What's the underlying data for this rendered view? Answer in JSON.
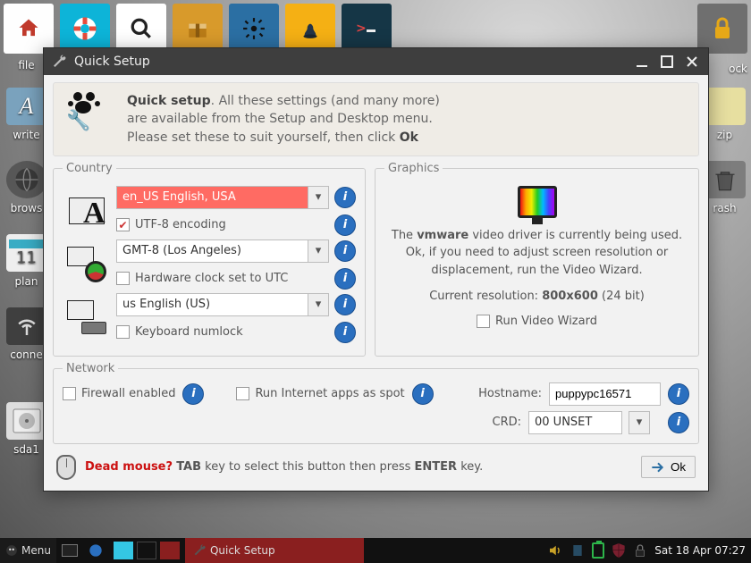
{
  "top_toolbar": {
    "labels": [
      "file",
      "",
      "",
      "",
      "",
      "",
      "",
      "",
      "ock"
    ]
  },
  "desktop_icons_left": [
    "file",
    "write",
    "brows",
    "plan",
    "conne",
    "sda1"
  ],
  "desktop_icons_right": [
    "ock",
    "zip",
    "rash"
  ],
  "calendar_day": "11",
  "window": {
    "title": "Quick Setup",
    "intro_bold": "Quick setup",
    "intro_rest": ". All these settings (and many more) are available from the Setup and Desktop menu. Please set these to suit yourself, then click ",
    "intro_ok": "Ok",
    "country_legend": "Country",
    "graphics_legend": "Graphics",
    "network_legend": "Network",
    "lang": {
      "code": "en_US",
      "label": "English, USA"
    },
    "lang_combined": "en_US     English, USA",
    "utf8": "UTF-8 encoding",
    "tz": {
      "code": "GMT-8",
      "label": "(Los Angeles)"
    },
    "tz_combined": "GMT-8     (Los Angeles)",
    "hw_utc": "Hardware clock set to UTC",
    "kb": {
      "code": "us",
      "label": "English (US)"
    },
    "kb_combined": "us           English (US)",
    "numlock": "Keyboard numlock",
    "graphics_text1_a": "The ",
    "graphics_text1_driver": "vmware",
    "graphics_text1_b": " video driver is currently being used. Ok, if you need to adjust screen resolution or displacement, run the Video Wizard.",
    "graphics_res_label": "Current resolution: ",
    "graphics_res": "800x600",
    "graphics_depth": "  (24 bit)",
    "run_video_wizard": "Run Video Wizard",
    "firewall": "Firewall enabled",
    "spot": "Run Internet apps as spot",
    "hostname_label": "Hostname:",
    "hostname": "puppypc16571",
    "crd_label": "CRD:",
    "crd_value": "00 UNSET",
    "deadmouse_red": "Dead mouse?",
    "deadmouse_rest_a": " ",
    "deadmouse_tab": "TAB",
    "deadmouse_mid": " key to select this button then press ",
    "deadmouse_enter": "ENTER",
    "deadmouse_end": " key.",
    "ok_btn": "Ok"
  },
  "taskbar": {
    "menu": "Menu",
    "task_label": "Quick Setup",
    "clock": "Sat 18 Apr 07:27"
  }
}
